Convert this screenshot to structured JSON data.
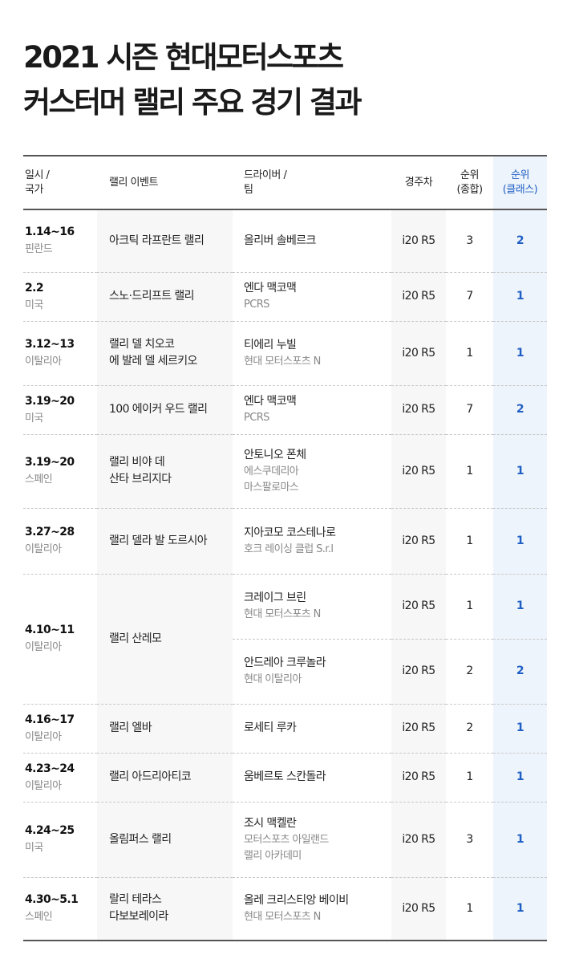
{
  "title": {
    "line1": "2021 시즌 현대모터스포츠",
    "line2": "커스터머 랠리 주요 경기 결과"
  },
  "header": {
    "date_line1": "일시 /",
    "date_line2": "국가",
    "event": "랠리 이벤트",
    "driver_line1": "드라이버 /",
    "driver_line2": "팀",
    "car": "경주차",
    "rank_overall_line1": "순위",
    "rank_overall_line2": "(종합)",
    "rank_class_line1": "순위",
    "rank_class_line2": "(클래스)"
  },
  "colors": {
    "accent": "#1f5fc4",
    "class_bg": "#eef4fc",
    "event_bg": "#f7f7f7"
  },
  "rows": [
    {
      "date": "1.14~16",
      "country": "핀란드",
      "event": [
        "아크틱 라프란트 랠리"
      ],
      "driver": "올리버 솔베르크",
      "team": [],
      "car": "i20 R5",
      "overall": "3",
      "class": "2"
    },
    {
      "date": "2.2",
      "country": "미국",
      "event": [
        "스노·드리프트 랠리"
      ],
      "driver": "엔다 맥코맥",
      "team": [
        "PCRS"
      ],
      "car": "i20 R5",
      "overall": "7",
      "class": "1"
    },
    {
      "date": "3.12~13",
      "country": "이탈리아",
      "event": [
        "랠리 델 치오코",
        "에 발레 델 세르키오"
      ],
      "driver": "티에리 누빌",
      "team": [
        "현대 모터스포츠 N"
      ],
      "car": "i20 R5",
      "overall": "1",
      "class": "1"
    },
    {
      "date": "3.19~20",
      "country": "미국",
      "event": [
        "100 에이커 우드 랠리"
      ],
      "driver": "엔다 맥코맥",
      "team": [
        "PCRS"
      ],
      "car": "i20 R5",
      "overall": "7",
      "class": "2"
    },
    {
      "date": "3.19~20",
      "country": "스페인",
      "event": [
        "랠리 비야 데",
        "산타 브리지다"
      ],
      "driver": "안토니오 폰체",
      "team": [
        "에스쿠데리아",
        "마스팔로마스"
      ],
      "car": "i20 R5",
      "overall": "1",
      "class": "1"
    },
    {
      "date": "3.27~28",
      "country": "이탈리아",
      "event": [
        "랠리 델라 발 도르시아"
      ],
      "driver": "지아코모 코스테나로",
      "team": [
        "호크 레이싱 클럽 S.r.l"
      ],
      "car": "i20 R5",
      "overall": "1",
      "class": "1"
    },
    {
      "date": "4.10~11",
      "country": "이탈리아",
      "event": [
        "랠리 산레모"
      ],
      "driver": "크레이그 브린",
      "team": [
        "현대 모터스포츠 N"
      ],
      "car": "i20 R5",
      "overall": "1",
      "class": "1"
    },
    {
      "driver": "안드레아 크루놀라",
      "team": [
        "현대 이탈리아"
      ],
      "car": "i20 R5",
      "overall": "2",
      "class": "2"
    },
    {
      "date": "4.16~17",
      "country": "이탈리아",
      "event": [
        "랠리 엘바"
      ],
      "driver": "로세티 루카",
      "team": [],
      "car": "i20 R5",
      "overall": "2",
      "class": "1"
    },
    {
      "date": "4.23~24",
      "country": "이탈리아",
      "event": [
        "랠리 아드리아티코"
      ],
      "driver": "움베르토 스칸돌라",
      "team": [],
      "car": "i20 R5",
      "overall": "1",
      "class": "1"
    },
    {
      "date": "4.24~25",
      "country": "미국",
      "event": [
        "올림퍼스 랠리"
      ],
      "driver": "조시 맥켈란",
      "team": [
        "모터스포츠 아일랜드",
        "랠리 아카데미"
      ],
      "car": "i20 R5",
      "overall": "3",
      "class": "1"
    },
    {
      "date": "4.30~5.1",
      "country": "스페인",
      "event": [
        "랄리 테라스",
        "다보보레이라"
      ],
      "driver": "올레 크리스티앙 베이비",
      "team": [
        "현대 모터스포츠 N"
      ],
      "car": "i20 R5",
      "overall": "1",
      "class": "1"
    }
  ]
}
